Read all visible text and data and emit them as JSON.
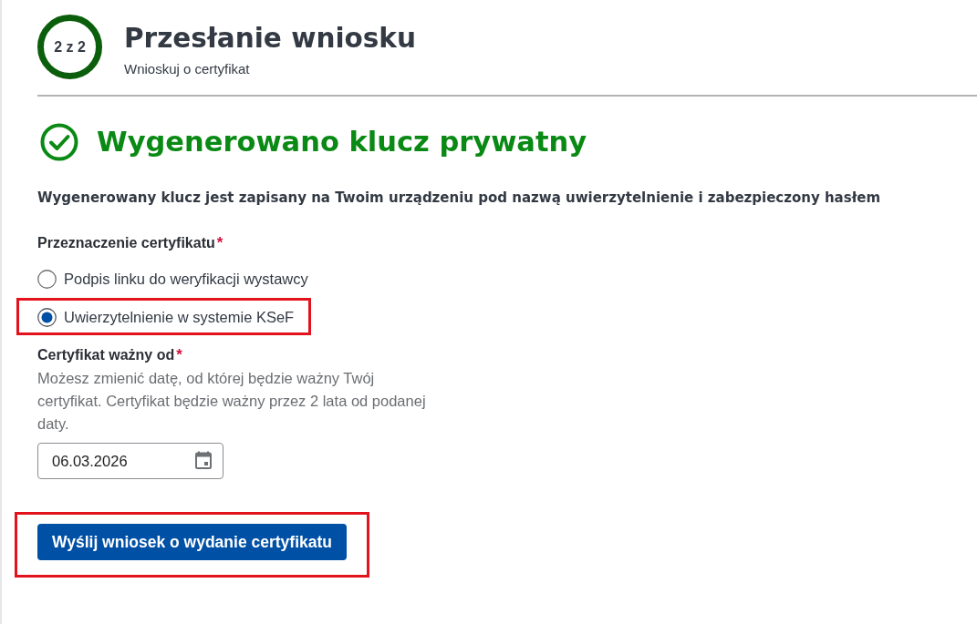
{
  "step_indicator": {
    "label": "2 z 2"
  },
  "header": {
    "title": "Przesłanie wniosku",
    "subtitle": "Wnioskuj o certyfikat"
  },
  "status": {
    "kind": "success",
    "heading": "Wygenerowano klucz prywatny"
  },
  "info_text": "Wygenerowany klucz jest zapisany na Twoim urządzeniu pod nazwą uwierzytelnienie i zabezpieczony hasłem",
  "purpose_field": {
    "label": "Przeznaczenie certyfikatu",
    "required_mark": "*",
    "options": [
      {
        "label": "Podpis linku do weryfikacji wystawcy",
        "selected": false,
        "highlighted": false
      },
      {
        "label": "Uwierzytelnienie w systemie KSeF",
        "selected": true,
        "highlighted": true
      }
    ]
  },
  "valid_from_field": {
    "label": "Certyfikat ważny od",
    "required_mark": "*",
    "help": "Możesz zmienić datę, od której będzie ważny Twój certyfikat. Certyfikat będzie ważny przez 2 lata od podanej daty.",
    "value": "06.03.2026"
  },
  "submit_button": {
    "label": "Wyślij wniosek o wydanie certyfikatu",
    "highlighted": true
  }
}
